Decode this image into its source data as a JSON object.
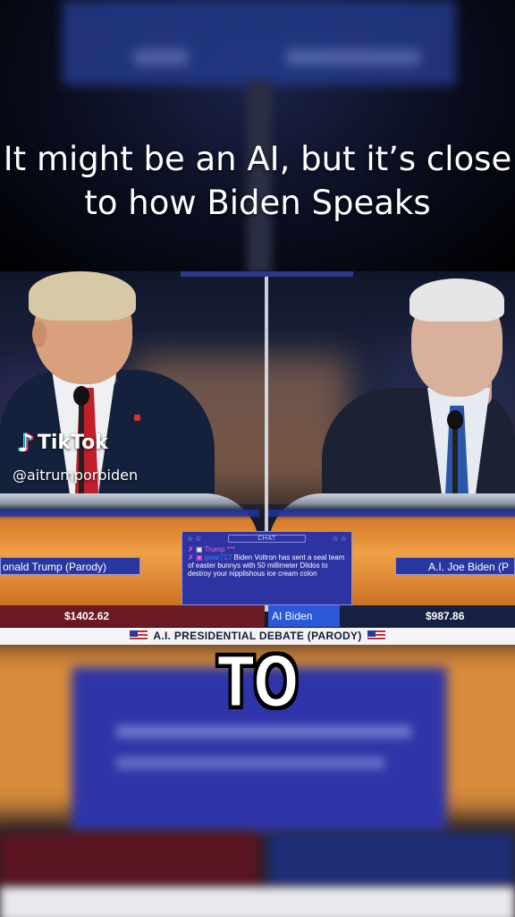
{
  "caption": "It might be an AI, but it’s close to how Biden Speaks",
  "watermark": {
    "brand": "TikTok",
    "username": "@aitrumporbiden"
  },
  "candidates": {
    "left_name": "onald Trump (Parody)",
    "right_name": "A.I. Joe Biden (P"
  },
  "chat": {
    "title": "CHAT",
    "stars_left": "☆ ☆",
    "stars_right": "☆ ☆",
    "line1_user": "Trump ***",
    "line2_user": "gwar717",
    "line2_message": "Biden Voltron has sent a seal team of easter bunnys with 50 millimeter Dildos to destroy your nipplishous ice cream colon"
  },
  "scores": {
    "left_amount": "$1402.62",
    "mid_label": "AI Biden",
    "right_amount": "$987.86"
  },
  "banner": "A.I. PRESIDENTIAL DEBATE (PARODY)",
  "subtitle_word": "TO",
  "colors": {
    "tiktok_cyan": "#25f4ee",
    "tiktok_pink": "#fe2c55",
    "chat_bg": "#2d33a0",
    "left_score_bg": "#6b1a24",
    "right_score_bg": "#162040"
  }
}
